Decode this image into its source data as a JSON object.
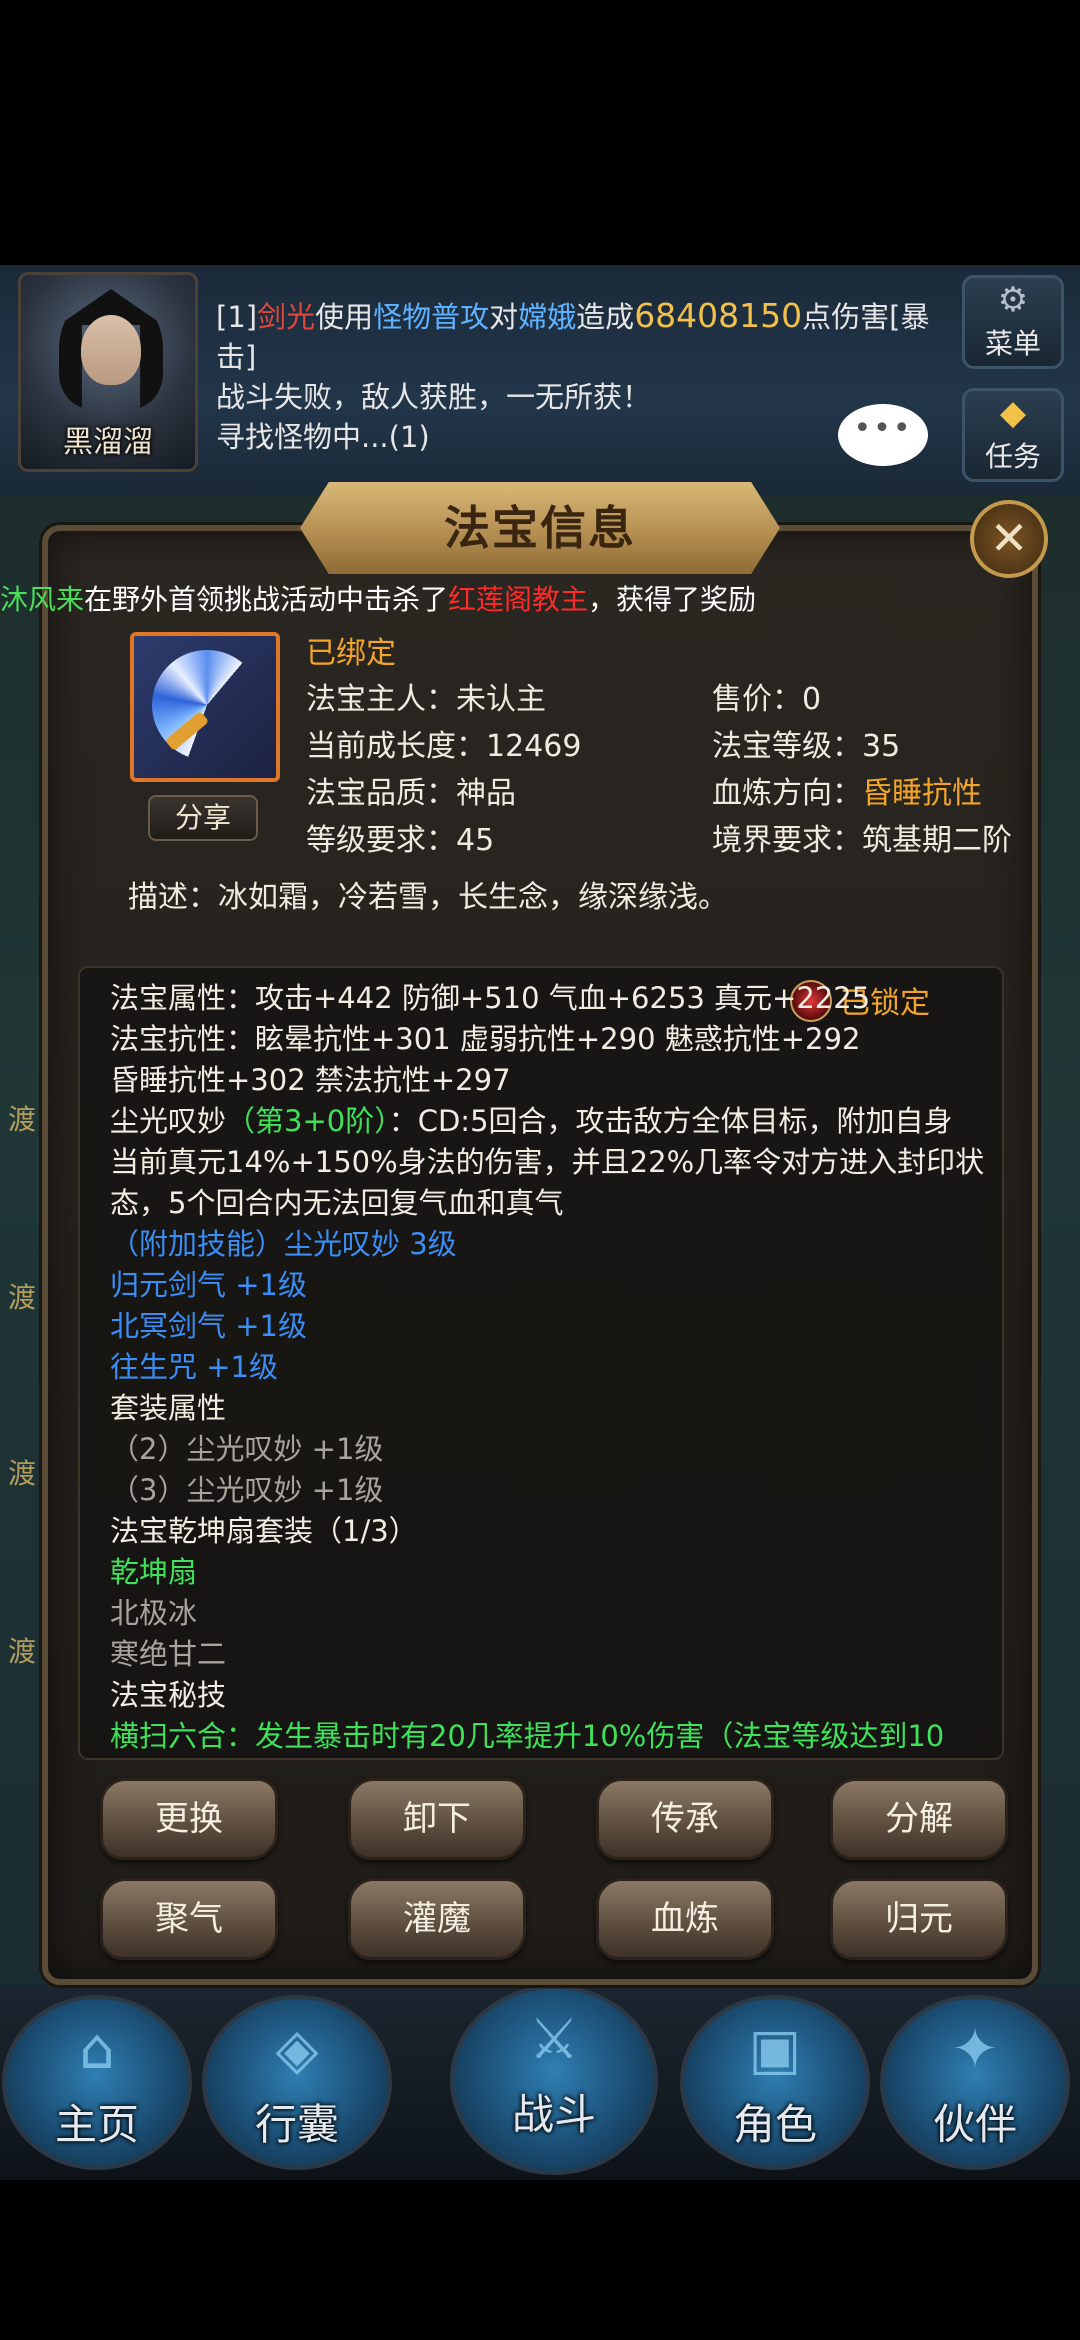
{
  "hud": {
    "player_name": "黑溜溜",
    "battle_log": {
      "line1_prefix": "[1]",
      "line1_attacker": "剑光",
      "line1_mid1": "使用",
      "line1_skill": "怪物普攻",
      "line1_mid2": "对",
      "line1_target": "嫦娥",
      "line1_mid3": "造成",
      "line1_damage": "68408150",
      "line1_suffix": "点伤害[暴击]",
      "line2": "战斗失败，敌人获胜，一无所获！",
      "line3": "寻找怪物中...(1)"
    },
    "chat_bubble": "•••",
    "menu_button": "菜单",
    "task_button": "任务"
  },
  "panel": {
    "title": "法宝信息",
    "close_icon": "✕",
    "broadcast": {
      "player": "沐风来",
      "text1": "在野外首领挑战活动中击杀了",
      "boss": "红莲阁教主",
      "text2": "，获得了奖励"
    },
    "share_button": "分享",
    "bound_status": "已绑定",
    "owner": "法宝主人：未认主",
    "price": "售价：0",
    "growth": "当前成长度：12469",
    "treasure_level": "法宝等级：35",
    "quality": "法宝品质：神品",
    "blood_direction_label": "血炼方向：",
    "blood_direction_value": "昏睡抗性",
    "level_req": "等级要求：45",
    "realm_req": "境界要求：筑基期二阶",
    "description": "描述：冰如霜，冷若雪，长生念，缘深缘浅。",
    "locked": "已锁定",
    "attr_lines": {
      "a1": "法宝属性：攻击+442 防御+510 气血+6253 真元+2225",
      "a2": "法宝抗性：眩晕抗性+301 虚弱抗性+290 魅惑抗性+292",
      "a3": "昏睡抗性+302 禁法抗性+297",
      "skill_name": "尘光叹妙",
      "skill_stage": "（第3+0阶）",
      "skill_text1": "：CD:5回合，攻击敌方全体目标，附加自身",
      "skill_text2": "当前真元14%+150%身法的伤害，并且22%几率令对方进入封印状",
      "skill_text3": "态，5个回合内无法回复气血和真气",
      "extra_skill": "（附加技能）尘光叹妙 3级",
      "b1": "归元剑气 +1级",
      "b2": "北冥剑气 +1级",
      "b3": "往生咒 +1级",
      "set_attr": "套装属性",
      "set1": "（2）尘光叹妙 +1级",
      "set2": "（3）尘光叹妙 +1级",
      "set_name": "法宝乾坤扇套装（1/3）",
      "set_piece1": "乾坤扇",
      "set_piece2": "北极冰",
      "set_piece3": "寒绝甘二",
      "secret": "法宝秘技",
      "secret_line": "横扫六合：发生暴击时有20几率提升10%伤害（法宝等级达到10"
    },
    "buttons": [
      "更换",
      "卸下",
      "传承",
      "分解",
      "聚气",
      "灌魔",
      "血炼",
      "归元"
    ]
  },
  "background": {
    "side_labels": [
      "渡",
      "渡",
      "渡",
      "渡"
    ]
  },
  "bottom_nav": [
    "主页",
    "行囊",
    "战斗",
    "角色",
    "伙伴"
  ],
  "colors": {
    "accent_orange": "#f3a52a",
    "skill_blue": "#3a8ef5",
    "set_green": "#3fe05a",
    "broadcast_red": "#ff2a2a"
  }
}
